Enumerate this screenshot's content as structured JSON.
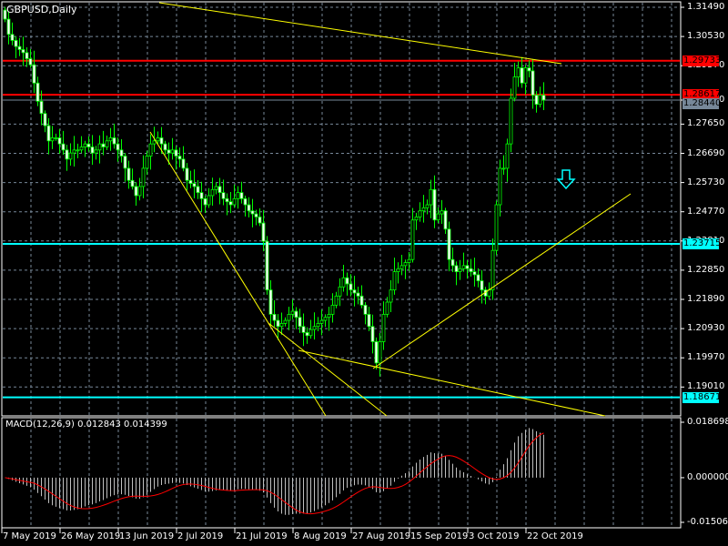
{
  "header": {
    "title": "GBPUSD,Daily"
  },
  "colors": {
    "bull_body": "#000000",
    "bear_body": "#ffffff",
    "wick": "#00ff00",
    "grid": "#778899",
    "resistance": "#ff0000",
    "support": "#00ffff",
    "trendline": "#ffff00",
    "macd_hist": "#c0c0c0",
    "macd_signal": "#ff0000",
    "bid_line": "#778899"
  },
  "chart_data": {
    "type": "candlestick",
    "symbol": "GBPUSD",
    "timeframe": "Daily",
    "ylim": [
      1.1845,
      1.3168
    ],
    "price_ticks": [
      "1.31490",
      "1.30530",
      "1.29570",
      "1.28440",
      "1.27650",
      "1.26690",
      "1.25730",
      "1.24770",
      "1.23810",
      "1.22850",
      "1.21890",
      "1.20930",
      "1.19970",
      "1.19010"
    ],
    "date_ticks": [
      "7 May 2019",
      "26 May 2019",
      "13 Jun 2019",
      "2 Jul 2019",
      "21 Jul 2019",
      "8 Aug 2019",
      "27 Aug 2019",
      "15 Sep 2019",
      "3 Oct 2019",
      "22 Oct 2019"
    ],
    "closes": [
      1.311,
      1.306,
      1.304,
      1.302,
      1.301,
      1.3,
      1.298,
      1.296,
      1.29,
      1.284,
      1.28,
      1.276,
      1.271,
      1.272,
      1.272,
      1.27,
      1.268,
      1.265,
      1.267,
      1.268,
      1.268,
      1.269,
      1.27,
      1.269,
      1.267,
      1.268,
      1.27,
      1.269,
      1.271,
      1.272,
      1.27,
      1.268,
      1.266,
      1.262,
      1.258,
      1.256,
      1.253,
      1.256,
      1.262,
      1.266,
      1.27,
      1.271,
      1.272,
      1.27,
      1.268,
      1.267,
      1.268,
      1.266,
      1.265,
      1.262,
      1.258,
      1.257,
      1.256,
      1.254,
      1.252,
      1.25,
      1.253,
      1.255,
      1.256,
      1.254,
      1.252,
      1.251,
      1.25,
      1.252,
      1.254,
      1.252,
      1.25,
      1.248,
      1.247,
      1.246,
      1.244,
      1.238,
      1.222,
      1.214,
      1.212,
      1.21,
      1.211,
      1.212,
      1.214,
      1.215,
      1.213,
      1.21,
      1.208,
      1.207,
      1.209,
      1.21,
      1.211,
      1.212,
      1.213,
      1.214,
      1.217,
      1.22,
      1.223,
      1.226,
      1.224,
      1.222,
      1.221,
      1.22,
      1.217,
      1.214,
      1.21,
      1.205,
      1.198,
      1.205,
      1.214,
      1.218,
      1.222,
      1.228,
      1.229,
      1.23,
      1.231,
      1.232,
      1.245,
      1.246,
      1.248,
      1.249,
      1.25,
      1.255,
      1.245,
      1.247,
      1.248,
      1.242,
      1.232,
      1.23,
      1.228,
      1.229,
      1.23,
      1.229,
      1.228,
      1.227,
      1.225,
      1.222,
      1.22,
      1.222,
      1.235,
      1.25,
      1.262,
      1.262,
      1.27,
      1.285,
      1.292,
      1.295,
      1.29,
      1.295,
      1.294,
      1.286,
      1.283,
      1.286,
      1.2844
    ],
    "horizontal_lines": [
      {
        "price": 1.29733,
        "label": "1.29733",
        "kind": "resistance"
      },
      {
        "price": 1.28617,
        "label": "1.28617",
        "kind": "resistance"
      },
      {
        "price": 1.23715,
        "label": "1.23715",
        "kind": "support"
      },
      {
        "price": 1.18671,
        "label": "1.18671",
        "kind": "support"
      }
    ],
    "bid": {
      "price": 1.2844,
      "label": "1.28440"
    },
    "macd": {
      "label": "MACD(12,26,9) 0.012843 0.014399",
      "ylim": [
        -0.01506,
        0.018698
      ],
      "ticks": [
        "0.018698",
        "0.000000",
        "-0.015060"
      ]
    }
  }
}
